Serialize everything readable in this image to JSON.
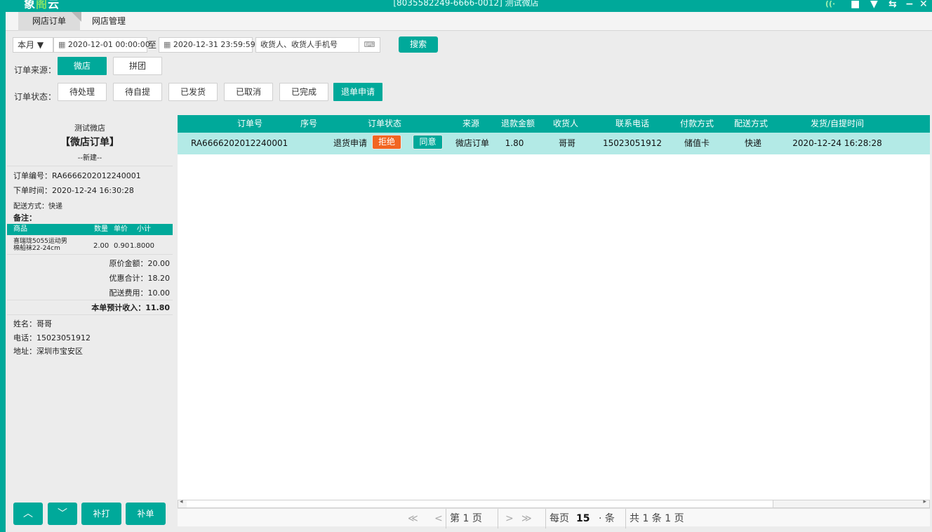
{
  "window": {
    "logo_a": "象",
    "logo_b": "阁",
    "logo_c": "云",
    "title": "[8035582249-6666-0012] 测试微店",
    "controls": [
      "wifi-icon",
      "message-icon",
      "shirt-icon",
      "swap-icon",
      "minimize-icon",
      "close-icon"
    ],
    "min_label": "−",
    "close_label": "✕"
  },
  "tabs": [
    {
      "label": "网店订单",
      "active": true
    },
    {
      "label": "网店管理",
      "active": false
    }
  ],
  "filters": {
    "period": "本月 ▼",
    "start": "2020-12-01 00:00:00",
    "to": "至",
    "end": "2020-12-31 23:59:59",
    "search_placeholder": "收货人、收货人手机号",
    "search_btn": "搜索",
    "source_label": "订单来源：",
    "sources": [
      "微店",
      "拼团"
    ],
    "status_label": "订单状态：",
    "statuses": [
      "待处理",
      "待自提",
      "已发货",
      "已取消",
      "已完成",
      "退单申请"
    ]
  },
  "receipt": {
    "shop": "测试微店",
    "title": "【微店订单】",
    "state": "--新建--",
    "order_no": "订单编号：RA6666202012240001",
    "order_time": "下单时间：2020-12-24 16:30:28",
    "delivery": "配送方式：快递",
    "remark": "备注：",
    "item_head": {
      "name": "商品",
      "qty": "数量",
      "price": "单价",
      "sub": "小计"
    },
    "item": {
      "name1": "喜瑞珑5055运动男",
      "name2": "棉船袜22-24cm",
      "qty": "2.00",
      "price": "0.90",
      "sub": "1.8000"
    },
    "orig": "原价金额：20.00",
    "discount": "优惠合计：18.20",
    "fee": "配送费用：10.00",
    "income": "本单预计收入：11.80",
    "name": "姓名：哥哥",
    "phone": "电话：15023051912",
    "addr": "地址：深圳市宝安区"
  },
  "bottom_buttons": {
    "up": "︿",
    "down": "﹀",
    "reprint": "补打",
    "supplement": "补单"
  },
  "table": {
    "headers": [
      "订单号",
      "序号",
      "订单状态",
      "来源",
      "退款金额",
      "收货人",
      "联系电话",
      "付款方式",
      "配送方式",
      "发货/自提时间"
    ],
    "row": {
      "order_no": "RA6666202012240001",
      "seq": "",
      "status": "退货申请",
      "reject": "拒绝",
      "agree": "同意",
      "source": "微店订单",
      "refund": "1.80",
      "receiver": "哥哥",
      "phone": "15023051912",
      "pay": "储值卡",
      "ship": "快递",
      "time": "2020-12-24 16:28:28"
    }
  },
  "pager": {
    "first": "≪",
    "prev": "<",
    "page_pre": "第",
    "page": "1",
    "page_post": "页",
    "next": ">",
    "last": "≫",
    "per_pre": "每页",
    "per": "15",
    "per_post": "· 条",
    "total": "共 1 条 1 页"
  },
  "colors": {
    "accent": "#00a99a",
    "reject": "#f26522",
    "row": "#b3eae6"
  }
}
